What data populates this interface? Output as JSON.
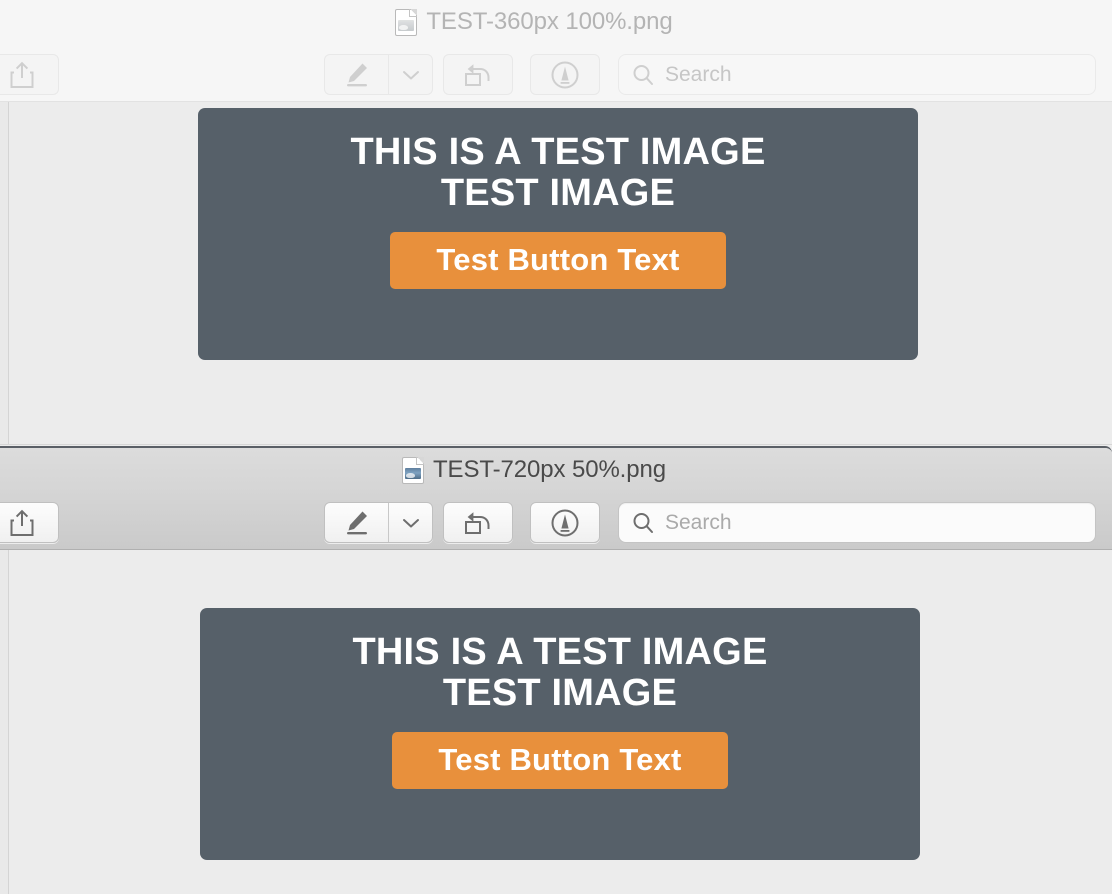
{
  "app": "Preview",
  "theme": {
    "content_background": "#ececec",
    "card_background": "#566069",
    "button_background": "#e8903c",
    "card_text": "#ffffff",
    "active_titlebar": "#d8d8d8",
    "inactive_titlebar": "#f6f6f6"
  },
  "windows": [
    {
      "id": "window-back",
      "state": "inactive",
      "title": "TEST-360px 100%.png",
      "doc_icon": "image-document-icon",
      "toolbar": {
        "share_label": "share-icon",
        "markup_pen_label": "highlighter-icon",
        "markup_caret_label": "chevron-down-icon",
        "rotate_label": "rotate-left-icon",
        "markup_tools_label": "markup-toolbar-icon",
        "search_placeholder": "Search",
        "search_value": "",
        "search_icon": "magnifier-icon"
      },
      "document": {
        "heading_line1": "THIS IS A TEST IMAGE",
        "heading_line2": "TEST IMAGE",
        "button_text": "Test Button Text"
      }
    },
    {
      "id": "window-front",
      "state": "active",
      "title": "TEST-720px 50%.png",
      "doc_icon": "image-document-icon",
      "toolbar": {
        "share_label": "share-icon",
        "markup_pen_label": "highlighter-icon",
        "markup_caret_label": "chevron-down-icon",
        "rotate_label": "rotate-left-icon",
        "markup_tools_label": "markup-toolbar-icon",
        "search_placeholder": "Search",
        "search_value": "",
        "search_icon": "magnifier-icon"
      },
      "document": {
        "heading_line1": "THIS IS A TEST IMAGE",
        "heading_line2": "TEST IMAGE",
        "button_text": "Test Button Text"
      }
    }
  ]
}
